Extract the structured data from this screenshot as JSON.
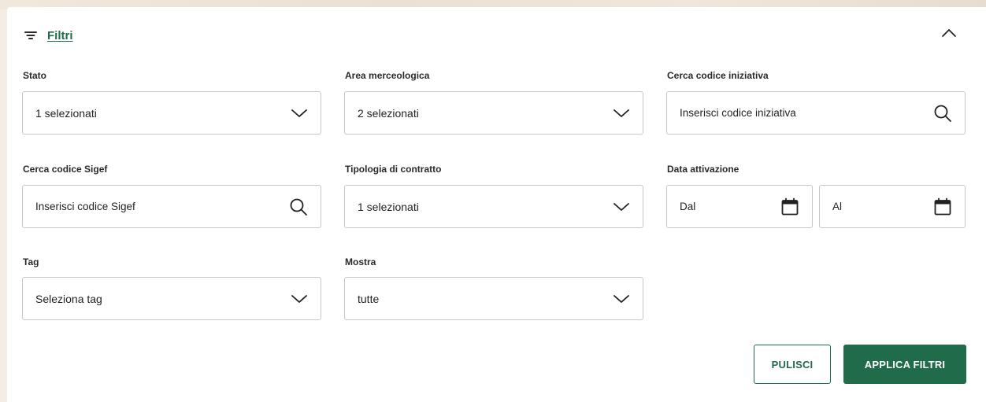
{
  "filters": {
    "title": "Filtri",
    "fields": {
      "stato": {
        "label": "Stato",
        "value": "1 selezionati"
      },
      "area": {
        "label": "Area merceologica",
        "value": "2 selezionati"
      },
      "codice_iniziativa": {
        "label": "Cerca codice iniziativa",
        "placeholder": "Inserisci codice iniziativa"
      },
      "codice_sigef": {
        "label": "Cerca codice Sigef",
        "placeholder": "Inserisci codice Sigef"
      },
      "tipologia": {
        "label": "Tipologia di contratto",
        "value": "1 selezionati"
      },
      "data_attivazione": {
        "label": "Data attivazione",
        "from_placeholder": "Dal",
        "to_placeholder": "Al"
      },
      "tag": {
        "label": "Tag",
        "value": "Seleziona tag"
      },
      "mostra": {
        "label": "Mostra",
        "value": "tutte"
      }
    },
    "actions": {
      "clear_label": "PULISCI",
      "apply_label": "APPLICA FILTRI"
    }
  },
  "colors": {
    "accent": "#1f6b4a",
    "border": "#c7c7c7"
  },
  "icons": {
    "header": "filter-lines-icon",
    "collapse": "chevron-up-icon",
    "dropdown": "chevron-down-icon",
    "search": "search-icon",
    "date": "calendar-icon"
  }
}
